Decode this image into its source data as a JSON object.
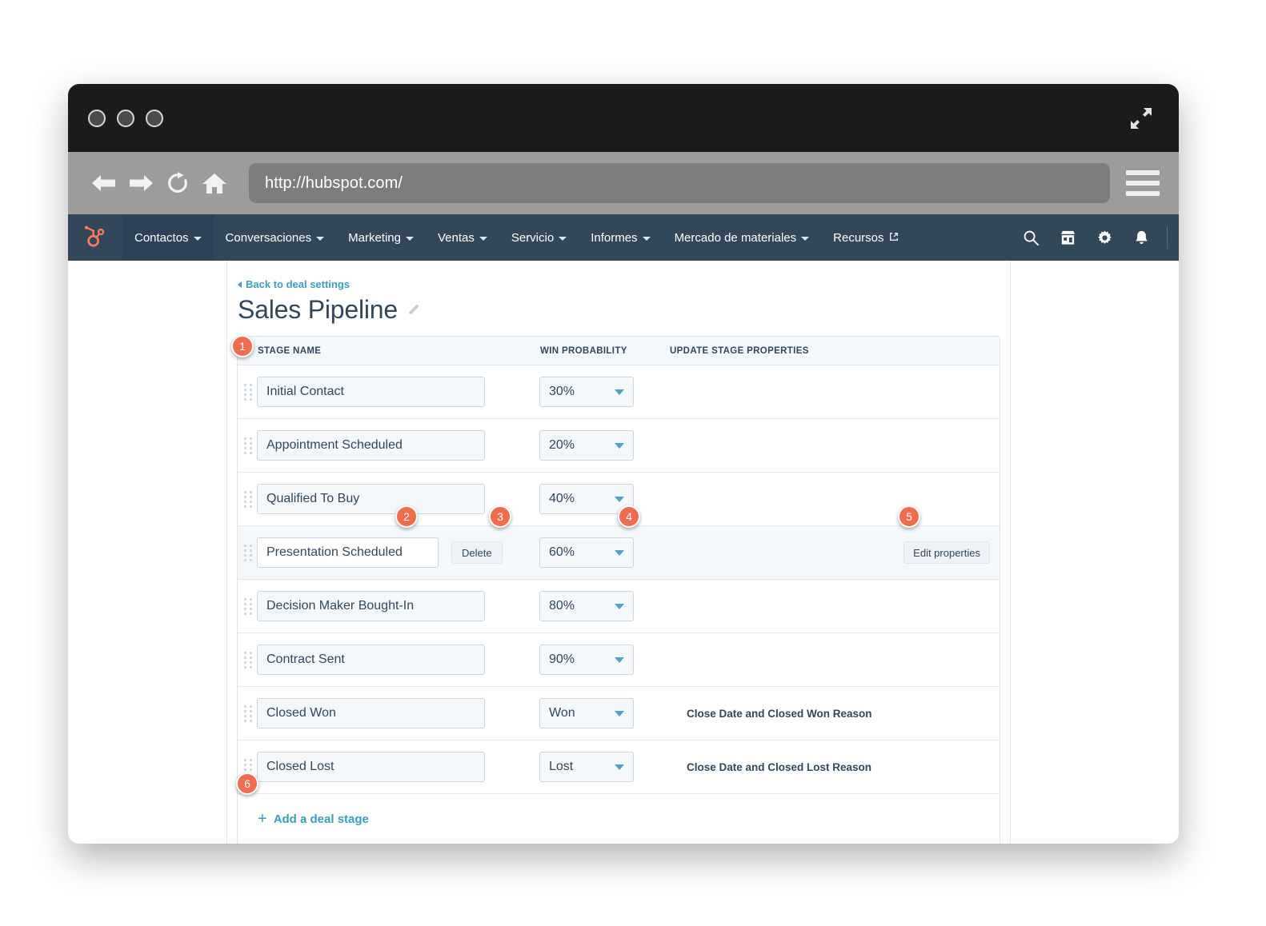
{
  "browser": {
    "url": "http://hubspot.com/",
    "traffic_lights": [
      "close",
      "minimize",
      "maximize"
    ],
    "icons": {
      "back": "back-arrow-icon",
      "forward": "forward-arrow-icon",
      "reload": "reload-icon",
      "home": "home-icon",
      "menu": "hamburger-menu-icon",
      "expand": "expand-arrows-icon"
    }
  },
  "hubspot_nav": {
    "logo": "hubspot-sprocket-logo",
    "items": [
      {
        "label": "Contactos",
        "has_caret": true,
        "active": true,
        "external": false
      },
      {
        "label": "Conversaciones",
        "has_caret": true,
        "active": false,
        "external": false
      },
      {
        "label": "Marketing",
        "has_caret": true,
        "active": false,
        "external": false
      },
      {
        "label": "Ventas",
        "has_caret": true,
        "active": false,
        "external": false
      },
      {
        "label": "Servicio",
        "has_caret": true,
        "active": false,
        "external": false
      },
      {
        "label": "Informes",
        "has_caret": true,
        "active": false,
        "external": false
      },
      {
        "label": "Mercado de materiales",
        "has_caret": true,
        "active": false,
        "external": false
      },
      {
        "label": "Recursos",
        "has_caret": false,
        "active": false,
        "external": true
      }
    ],
    "actions": [
      "search-icon",
      "marketplace-icon",
      "settings-gear-icon",
      "notifications-bell-icon"
    ]
  },
  "page": {
    "back_link": "Back to deal settings",
    "title": "Sales Pipeline",
    "edit_title_icon": "pencil-icon"
  },
  "table": {
    "headers": {
      "stage_name": "STAGE NAME",
      "win_probability": "WIN PROBABILITY",
      "update_stage_properties": "UPDATE STAGE PROPERTIES"
    },
    "rows": [
      {
        "stage": "Initial Contact",
        "probability": "30%",
        "properties": "",
        "highlight": false,
        "delete_label": "",
        "edit_label": ""
      },
      {
        "stage": "Appointment Scheduled",
        "probability": "20%",
        "properties": "",
        "highlight": false,
        "delete_label": "",
        "edit_label": ""
      },
      {
        "stage": "Qualified To Buy",
        "probability": "40%",
        "properties": "",
        "highlight": false,
        "delete_label": "",
        "edit_label": ""
      },
      {
        "stage": "Presentation Scheduled",
        "probability": "60%",
        "properties": "",
        "highlight": true,
        "delete_label": "Delete",
        "edit_label": "Edit properties"
      },
      {
        "stage": "Decision Maker Bought-In",
        "probability": "80%",
        "properties": "",
        "highlight": false,
        "delete_label": "",
        "edit_label": ""
      },
      {
        "stage": "Contract Sent",
        "probability": "90%",
        "properties": "",
        "highlight": false,
        "delete_label": "",
        "edit_label": ""
      },
      {
        "stage": "Closed Won",
        "probability": "Won",
        "properties": "Close Date and Closed Won Reason",
        "highlight": false,
        "delete_label": "",
        "edit_label": ""
      },
      {
        "stage": "Closed Lost",
        "probability": "Lost",
        "properties": "Close Date and Closed Lost Reason",
        "highlight": false,
        "delete_label": "",
        "edit_label": ""
      }
    ],
    "add_stage_label": "Add a deal stage",
    "add_stage_icon": "plus-icon"
  },
  "annotations": {
    "badges": [
      "1",
      "2",
      "3",
      "4",
      "5",
      "6"
    ]
  },
  "colors": {
    "hubspot_orange": "#ff7a59",
    "nav_navy": "#33475b",
    "link_blue": "#3a9ec4",
    "badge_coral": "#ef6c4d",
    "row_highlight": "#f5f8fa",
    "border": "#dfe3eb"
  }
}
